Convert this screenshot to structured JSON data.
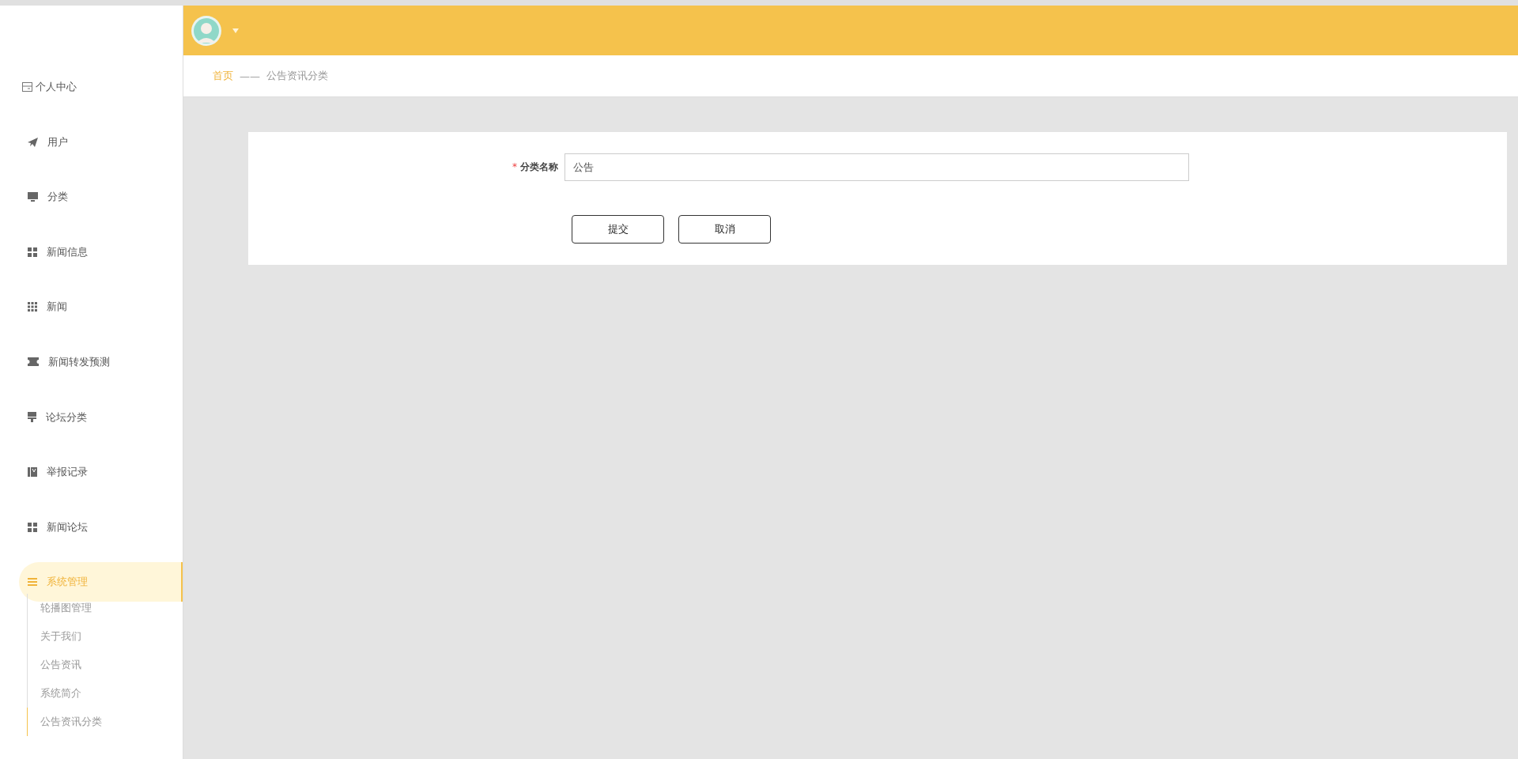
{
  "sidebar": {
    "items": [
      {
        "label": "个人中心",
        "selected": false
      },
      {
        "label": "用户",
        "selected": false
      },
      {
        "label": "分类",
        "selected": false
      },
      {
        "label": "新闻信息",
        "selected": false
      },
      {
        "label": "新闻",
        "selected": false
      },
      {
        "label": "新闻转发预测",
        "selected": false
      },
      {
        "label": "论坛分类",
        "selected": false
      },
      {
        "label": "举报记录",
        "selected": false
      },
      {
        "label": "新闻论坛",
        "selected": false
      },
      {
        "label": "系统管理",
        "selected": true,
        "children": [
          {
            "label": "轮播图管理",
            "selected": false
          },
          {
            "label": "关于我们",
            "selected": false
          },
          {
            "label": "公告资讯",
            "selected": false
          },
          {
            "label": "系统简介",
            "selected": false
          },
          {
            "label": "公告资讯分类",
            "selected": true
          }
        ]
      }
    ]
  },
  "breadcrumb": {
    "home": "首页",
    "separator": "——",
    "current": "公告资讯分类"
  },
  "form": {
    "fields": [
      {
        "label": "分类名称",
        "required_mark": "*",
        "value": "公告"
      }
    ],
    "buttons": [
      "提交",
      "取消"
    ]
  }
}
